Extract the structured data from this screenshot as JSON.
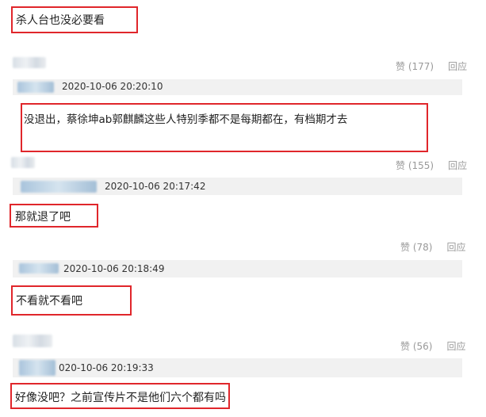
{
  "comments": [
    {
      "text": "杀人台也没必要看",
      "likes_label": "赞 (177)",
      "reply_label": "回应",
      "timestamp": "2020-10-06 20:20:10"
    },
    {
      "text": "没退出，蔡徐坤ab郭麒麟这些人特别季都不是每期都在，有档期才去",
      "likes_label": "赞 (155)",
      "reply_label": "回应",
      "timestamp": "2020-10-06 20:17:42"
    },
    {
      "text": "那就退了吧",
      "likes_label": "赞 (78)",
      "reply_label": "回应",
      "timestamp": "2020-10-06 20:18:49"
    },
    {
      "text": "不看就不看吧",
      "likes_label": "赞 (56)",
      "reply_label": "回应",
      "timestamp": "020-10-06 20:19:33"
    },
    {
      "text": "好像没吧？之前宣传片不是他们六个都有吗"
    }
  ],
  "colors": {
    "highlight": "#e0262b",
    "meta_text": "#999999",
    "bar_bg": "#f1f1f1"
  }
}
